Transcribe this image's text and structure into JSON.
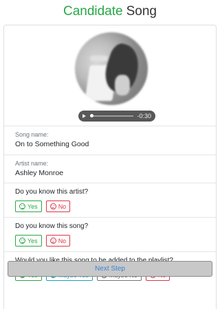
{
  "header": {
    "title_accent": "Candidate",
    "title_rest": "Song"
  },
  "player": {
    "time": "-0:30"
  },
  "song": {
    "name_label": "Song name:",
    "name": "On to Something Good"
  },
  "artist": {
    "name_label": "Artist name:",
    "name": "Ashley Monroe"
  },
  "q_artist": {
    "text": "Do you know this artist?",
    "yes": "Yes",
    "no": "No"
  },
  "q_song": {
    "text": "Do you know this song?",
    "yes": "Yes",
    "no": "No"
  },
  "q_playlist": {
    "text": "Would you like this song to be added to the playlist?",
    "yes": "Yes",
    "maybe_yes": "Maybe Yes",
    "maybe_no": "Maybe No",
    "no": "No"
  },
  "next_step": "Next Step",
  "colors": {
    "accent": "#28a745",
    "danger": "#dc3545",
    "info": "#17a2b8",
    "secondary": "#6c757d"
  }
}
